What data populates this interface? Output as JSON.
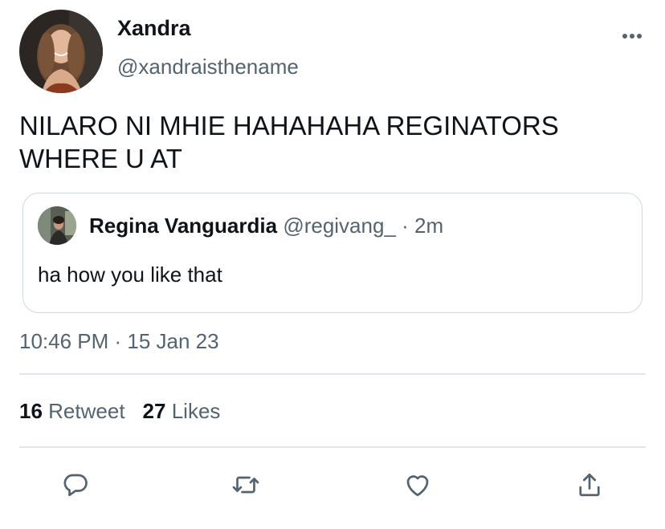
{
  "tweet": {
    "author": {
      "display_name": "Xandra",
      "handle": "@xandraisthename",
      "avatar_icon": "profile-photo"
    },
    "more_icon": "more-dots-icon",
    "text": "NILARO NI MHIE HAHAHAHA REGINATORS WHERE U AT",
    "quoted": {
      "display_name": "Regina Vanguardia",
      "handle": "@regivang_",
      "separator": "·",
      "time": "2m",
      "text": "ha how you like that"
    },
    "timestamp": "10:46 PM · 15 Jan 23",
    "stats": {
      "retweet_count": "16",
      "retweet_label": "Retweet",
      "like_count": "27",
      "like_label": "Likes"
    },
    "actions": [
      {
        "name": "reply",
        "icon": "reply-bubble-icon"
      },
      {
        "name": "retweet",
        "icon": "retweet-arrows-icon"
      },
      {
        "name": "like",
        "icon": "heart-icon"
      },
      {
        "name": "share",
        "icon": "share-upload-icon"
      }
    ],
    "colors": {
      "text_primary": "#0f1419",
      "text_secondary": "#536471",
      "border": "#cfd9de",
      "divider": "#e1e8ed"
    }
  }
}
